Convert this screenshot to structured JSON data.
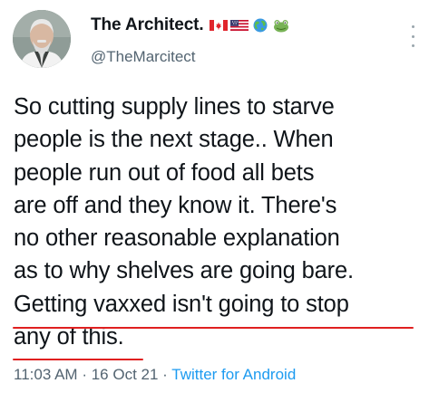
{
  "author": {
    "display_name": "The Architect.",
    "handle": "@TheMarcitect",
    "name_emojis": [
      "canada-flag-icon",
      "us-flag-icon",
      "globe-icon",
      "frog-icon"
    ]
  },
  "tweet": {
    "lines": [
      "So cutting supply lines to starve",
      "people is the next stage.. When",
      "people run out of food all bets",
      "are off and they know it. There's",
      "no other reasonable explanation",
      "as to why shelves are going bare.",
      "Getting vaxxed isn't going to stop",
      "any of this."
    ],
    "underlined_lines": [
      6,
      7
    ],
    "underline_color": "#e02020"
  },
  "meta": {
    "time": "11:03 AM",
    "separator": "·",
    "date": "16 Oct 21",
    "source": "Twitter for Android"
  },
  "colors": {
    "text": "#0f1419",
    "secondary": "#536471",
    "link": "#1d9bf0"
  }
}
